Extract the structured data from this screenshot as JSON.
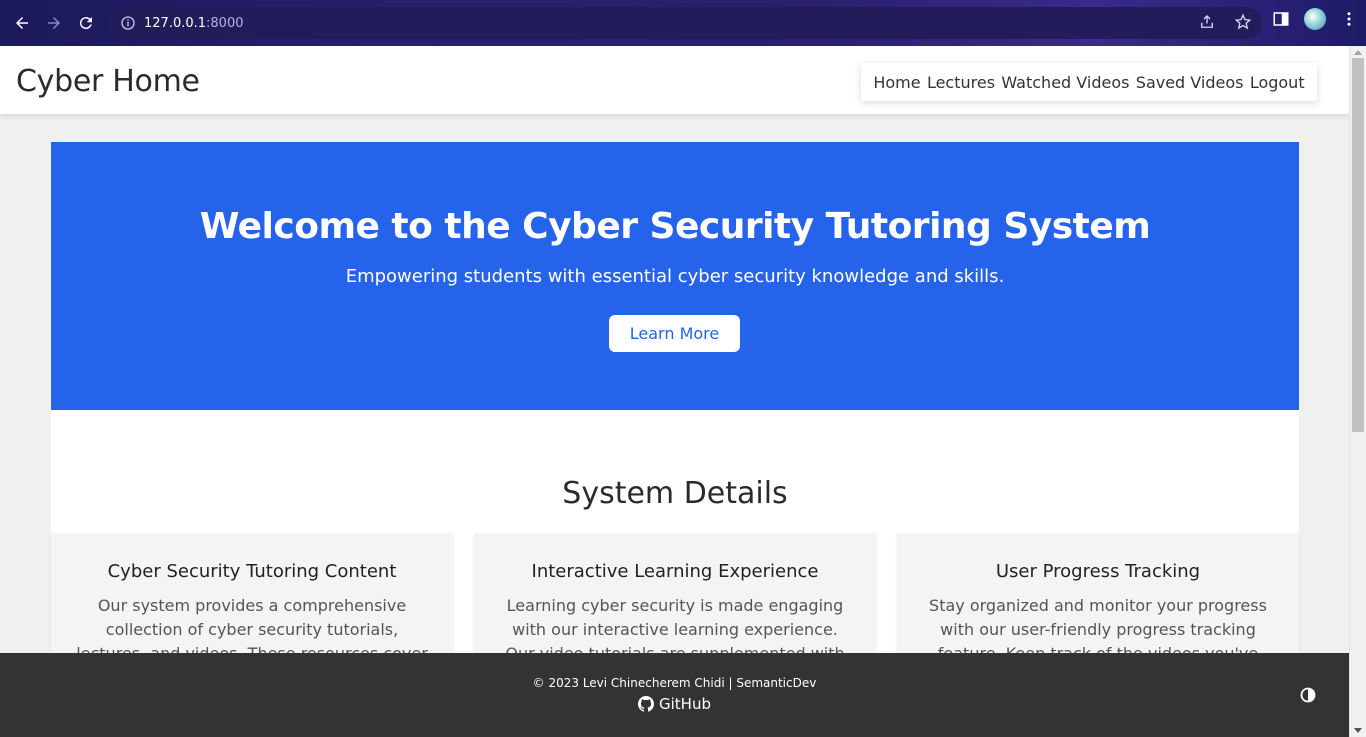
{
  "browser": {
    "url_host": "127.0.0.1",
    "url_port": ":8000"
  },
  "site": {
    "brand": "Cyber Home",
    "nav": [
      "Home",
      "Lectures",
      "Watched Videos",
      "Saved Videos",
      "Logout"
    ]
  },
  "hero": {
    "title": "Welcome to the Cyber Security Tutoring System",
    "subtitle": "Empowering students with essential cyber security knowledge and skills.",
    "button": "Learn More",
    "color": "#2563eb"
  },
  "details": {
    "heading": "System Details",
    "cards": [
      {
        "title": "Cyber Security Tutoring Content",
        "text": "Our system provides a comprehensive collection of cyber security tutorials, lectures, and videos. These resources cover a wide range of topics"
      },
      {
        "title": "Interactive Learning Experience",
        "text": "Learning cyber security is made engaging with our interactive learning experience. Our video tutorials are supplemented with quizzes"
      },
      {
        "title": "User Progress Tracking",
        "text": "Stay organized and monitor your progress with our user-friendly progress tracking feature. Keep track of the videos you've watched, quizzes"
      }
    ]
  },
  "footer": {
    "copyright": "© 2023 Levi Chinecherem Chidi | SemanticDev",
    "github": "GitHub",
    "background": "#333333"
  },
  "icons": {
    "back": "back-arrow-icon",
    "forward": "forward-arrow-icon",
    "reload": "reload-icon",
    "info": "site-info-icon",
    "share": "share-icon",
    "bookmark": "star-icon",
    "side_panel": "side-panel-icon",
    "menu": "kebab-menu-icon",
    "github": "github-icon",
    "theme": "theme-toggle-icon"
  }
}
